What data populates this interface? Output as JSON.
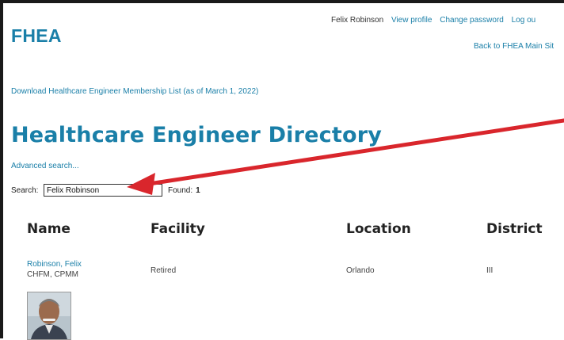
{
  "header": {
    "logo": "FHEA",
    "user_name": "Felix Robinson",
    "view_profile": "View profile",
    "change_password": "Change password",
    "log_out": "Log ou",
    "back_link": "Back to FHEA Main Sit"
  },
  "download_link": "Download Healthcare Engineer Membership List (as of March 1, 2022)",
  "page_title": "Healthcare Engineer Directory",
  "advanced_search": "Advanced search...",
  "search": {
    "label": "Search:",
    "value": "Felix Robinson",
    "found_label": "Found:",
    "found_count": "1"
  },
  "table": {
    "headers": [
      "Name",
      "Facility",
      "Location",
      "District"
    ],
    "rows": [
      {
        "name": "Robinson, Felix",
        "credentials": "CHFM, CPMM",
        "facility": "Retired",
        "location": "Orlando",
        "district": "III"
      }
    ]
  },
  "annotation": {
    "arrow_color": "#d9262c"
  }
}
